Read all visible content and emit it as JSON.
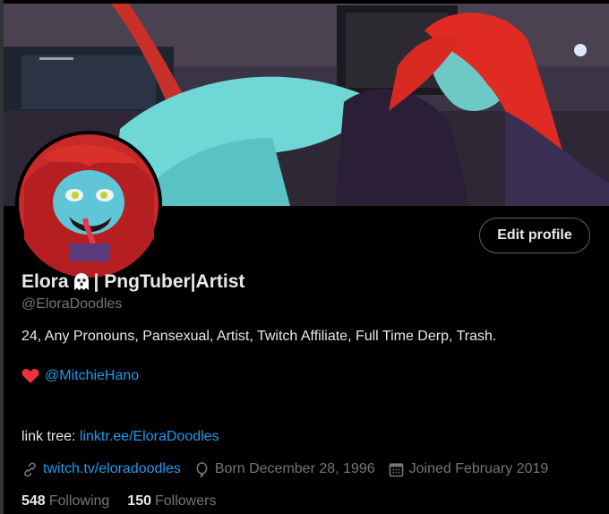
{
  "profile": {
    "name_prefix": "Elora",
    "name_suffix": "| PngTuber|Artist",
    "handle": "@EloraDoodles",
    "bio": "24, Any Pronouns, Pansexual, Artist, Twitch Affiliate, Full Time Derp,  Trash.",
    "partner_handle": "@MitchieHano",
    "linktree_label": "link tree: ",
    "linktree_url": "linktr.ee/EloraDoodles",
    "website": "twitch.tv/eloradoodles",
    "born": "Born December 28, 1996",
    "joined": "Joined February 2019",
    "following_count": "548",
    "following_label": "Following",
    "followers_count": "150",
    "followers_label": "Followers"
  },
  "actions": {
    "edit_profile_label": "Edit profile"
  },
  "icons": {
    "name_emoji": "ghost-icon",
    "heart": "red-heart-icon",
    "website": "link-icon",
    "born": "balloon-icon",
    "joined": "calendar-icon"
  },
  "colors": {
    "background": "#000000",
    "text": "#e7e9ea",
    "muted": "#71767b",
    "link": "#1d9bf0",
    "heart": "#f91880",
    "button_border": "#536471"
  }
}
